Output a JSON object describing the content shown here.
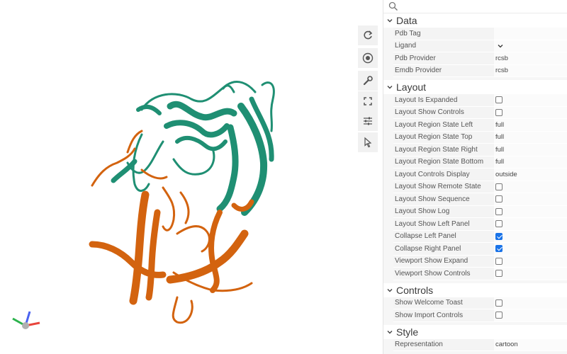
{
  "search": {
    "placeholder": ""
  },
  "viewport": {
    "toolbar": [
      {
        "icon": "reset-zoom-icon"
      },
      {
        "icon": "screenshot-icon"
      },
      {
        "icon": "wrench-icon"
      },
      {
        "icon": "expand-icon"
      },
      {
        "icon": "settings-sliders-icon"
      },
      {
        "icon": "selection-mode-icon"
      }
    ],
    "colors": {
      "chainA": "#1f8f73",
      "chainB": "#d3630f"
    }
  },
  "sections": {
    "data": {
      "title": "Data",
      "pdb_tag": {
        "label": "Pdb Tag",
        "value": ""
      },
      "ligand": {
        "label": "Ligand",
        "value": ""
      },
      "pdb_provider": {
        "label": "Pdb Provider",
        "value": "rcsb"
      },
      "emdb_provider": {
        "label": "Emdb Provider",
        "value": "rcsb"
      }
    },
    "layout": {
      "title": "Layout",
      "is_expanded": {
        "label": "Layout Is Expanded",
        "checked": false
      },
      "show_controls": {
        "label": "Layout Show Controls",
        "checked": false
      },
      "region_left": {
        "label": "Layout Region State Left",
        "value": "full"
      },
      "region_top": {
        "label": "Layout Region State Top",
        "value": "full"
      },
      "region_right": {
        "label": "Layout Region State Right",
        "value": "full"
      },
      "region_bottom": {
        "label": "Layout Region State Bottom",
        "value": "full"
      },
      "controls_display": {
        "label": "Layout Controls Display",
        "value": "outside"
      },
      "show_remote_state": {
        "label": "Layout Show Remote State",
        "checked": false
      },
      "show_sequence": {
        "label": "Layout Show Sequence",
        "checked": false
      },
      "show_log": {
        "label": "Layout Show Log",
        "checked": false
      },
      "show_left_panel": {
        "label": "Layout Show Left Panel",
        "checked": false
      },
      "collapse_left": {
        "label": "Collapse Left Panel",
        "checked": true
      },
      "collapse_right": {
        "label": "Collapse Right Panel",
        "checked": true
      },
      "viewport_show_expand": {
        "label": "Viewport Show Expand",
        "checked": false
      },
      "viewport_show_controls": {
        "label": "Viewport Show Controls",
        "checked": false
      }
    },
    "controls": {
      "title": "Controls",
      "show_welcome_toast": {
        "label": "Show Welcome Toast",
        "checked": false
      },
      "show_import_controls": {
        "label": "Show Import Controls",
        "checked": false
      }
    },
    "style": {
      "title": "Style",
      "representation": {
        "label": "Representation",
        "value": "cartoon"
      }
    }
  }
}
